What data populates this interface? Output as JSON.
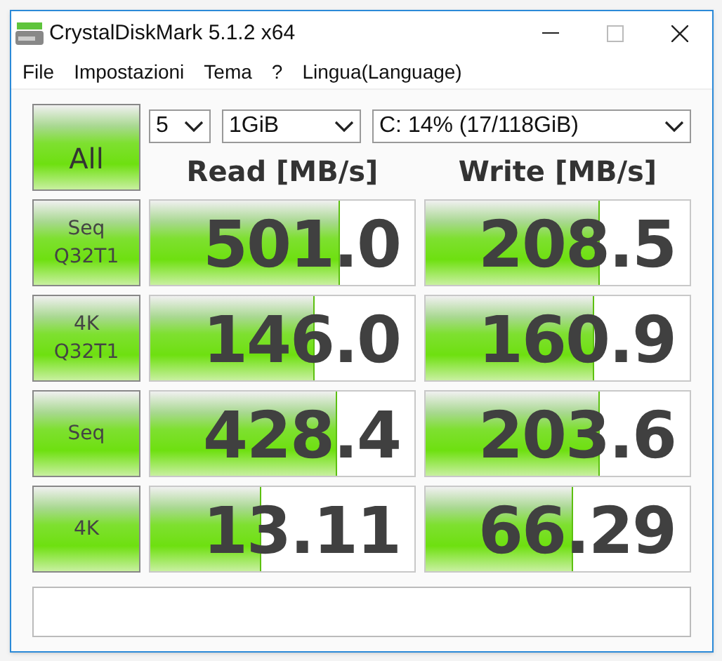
{
  "window": {
    "title": "CrystalDiskMark 5.1.2 x64"
  },
  "menu": [
    "File",
    "Impostazioni",
    "Tema",
    "?",
    "Lingua(Language)"
  ],
  "all_button": "All",
  "selects": [
    {
      "value": "5"
    },
    {
      "value": "1GiB"
    },
    {
      "value": "C: 14% (17/118GiB)"
    }
  ],
  "headers": [
    "Read [MB/s]",
    "Write [MB/s]"
  ],
  "tests": [
    {
      "label": "Seq\nQ32T1",
      "read": {
        "reading": "501.0",
        "level": 0.72
      },
      "write": {
        "reading": "208.5",
        "level": 0.66
      }
    },
    {
      "label": "4K\nQ32T1",
      "read": {
        "reading": "146.0",
        "level": 0.62
      },
      "write": {
        "reading": "160.9",
        "level": 0.64
      }
    },
    {
      "label": "Seq",
      "read": {
        "reading": "428.4",
        "level": 0.71
      },
      "write": {
        "reading": "203.6",
        "level": 0.66
      }
    },
    {
      "label": "4K",
      "read": {
        "reading": "13.11",
        "level": 0.42
      },
      "write": {
        "reading": "66.29",
        "level": 0.56
      }
    }
  ]
}
